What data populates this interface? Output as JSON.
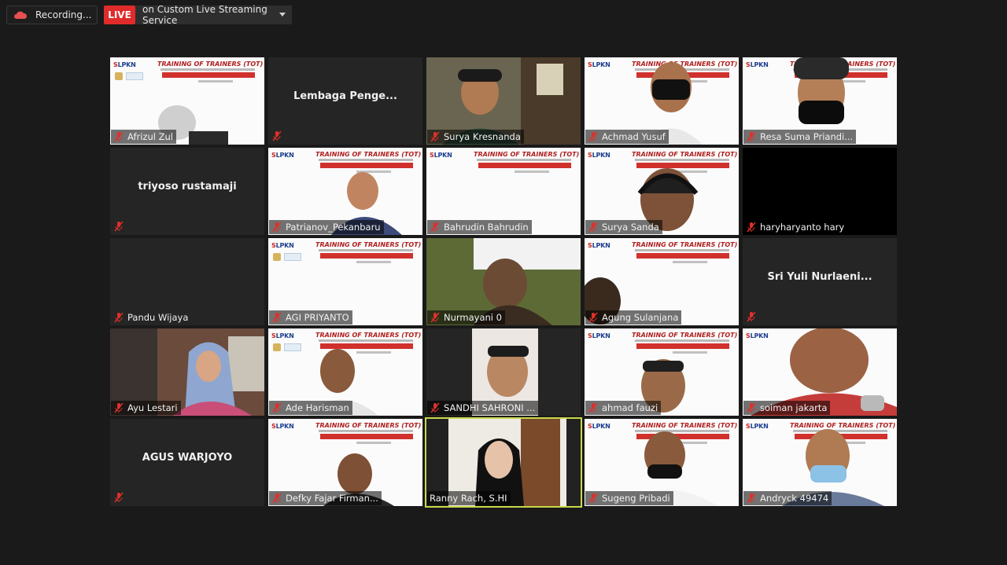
{
  "topbar": {
    "recording_label": "Recording...",
    "live_label": "LIVE",
    "stream_label": "on Custom Live Streaming Service"
  },
  "slide": {
    "logo_text": "LPKN",
    "title": "TRAINING OF TRAINERS (TOT)"
  },
  "participants": [
    {
      "name": "Afrizul Zul"
    },
    {
      "name": "",
      "display_name": "Lembaga  Penge..."
    },
    {
      "name": "Surya Kresnanda"
    },
    {
      "name": "Achmad Yusuf"
    },
    {
      "name": "Resa Suma Priandi..."
    },
    {
      "name": "",
      "display_name": "triyoso rustamaji"
    },
    {
      "name": "Patrianov_Pekanbaru"
    },
    {
      "name": "Bahrudin Bahrudin"
    },
    {
      "name": "Surya Sanda"
    },
    {
      "name": "haryharyanto hary"
    },
    {
      "name": "Pandu Wijaya"
    },
    {
      "name": "AGI PRIYANTO"
    },
    {
      "name": "Nurmayani 0"
    },
    {
      "name": "Agung Sulanjana"
    },
    {
      "name": "",
      "display_name": "Sri  Yuli  Nurlaeni..."
    },
    {
      "name": "Ayu Lestari"
    },
    {
      "name": "Ade Harisman"
    },
    {
      "name": "SANDHI SAHRONI ..."
    },
    {
      "name": "ahmad fauzi"
    },
    {
      "name": "soiman jakarta"
    },
    {
      "name": "",
      "display_name": "AGUS WARJOYO"
    },
    {
      "name": "Defky Fajar Firman..."
    },
    {
      "name": "Ranny Rach, S.HI",
      "active_speaker": true
    },
    {
      "name": "Sugeng Pribadi"
    },
    {
      "name": "Andryck 49474"
    }
  ],
  "colors": {
    "live_red": "#e02b2b",
    "active_speaker_border": "#c9d84a",
    "mic_muted": "#e0302a"
  }
}
